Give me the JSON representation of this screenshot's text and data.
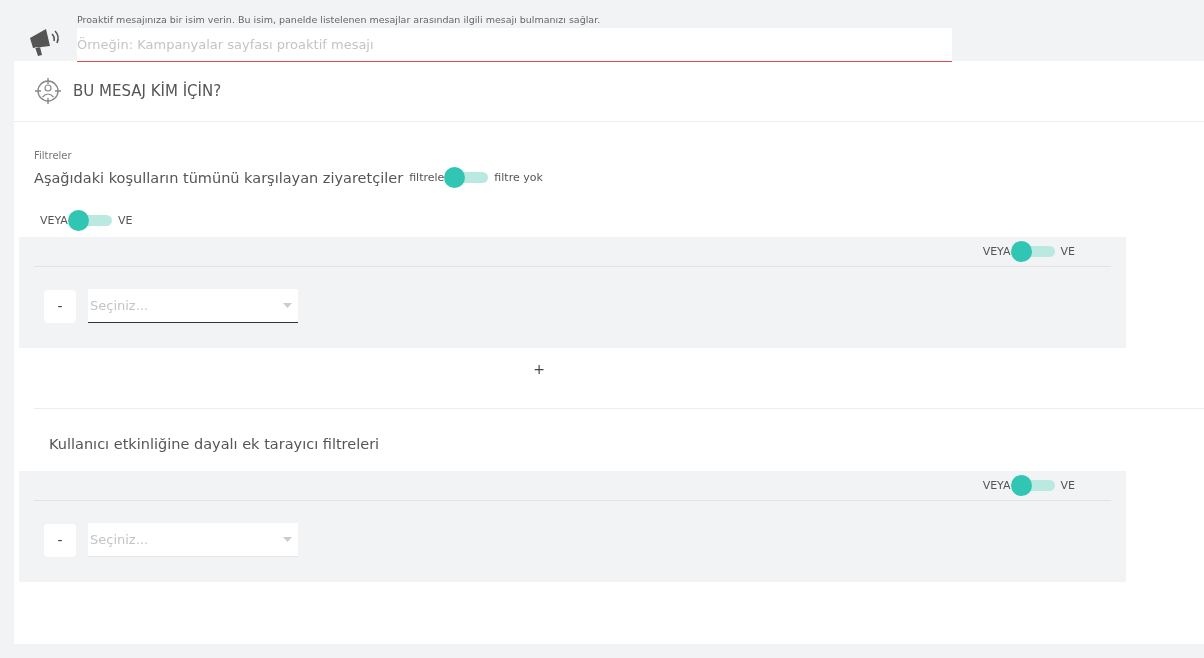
{
  "name_field": {
    "hint": "Proaktif mesajınıza bir isim verin. Bu isim, panelde listelenen mesajlar arasından ilgili mesajı bulmanızı sağlar.",
    "placeholder": "Örneğin: Kampanyalar sayfası proaktif mesajı",
    "invalid": true
  },
  "section": {
    "title": "BU MESAJ KİM İÇİN?"
  },
  "filters": {
    "caption": "Filtreler",
    "heading": "Aşağıdaki koşulların tümünü karşılayan ziyaretçiler",
    "filter_toggle": {
      "left": "filtrele",
      "right": "filtre yok",
      "on": false
    },
    "logic_toggle": {
      "left": "VEYA",
      "right": "VE",
      "on": false
    },
    "groups": [
      {
        "logic_toggle": {
          "left": "VEYA",
          "right": "VE",
          "on": false
        },
        "rows": [
          {
            "remove": "-",
            "select": {
              "placeholder": "Seçiniz...",
              "invalid": true
            }
          }
        ]
      }
    ],
    "add": "+"
  },
  "browser_filters": {
    "heading": "Kullanıcı etkinliğine dayalı ek tarayıcı filtreleri",
    "groups": [
      {
        "logic_toggle": {
          "left": "VEYA",
          "right": "VE",
          "on": false
        },
        "rows": [
          {
            "remove": "-",
            "select": {
              "placeholder": "Seçiniz...",
              "invalid": false
            }
          }
        ]
      }
    ]
  }
}
